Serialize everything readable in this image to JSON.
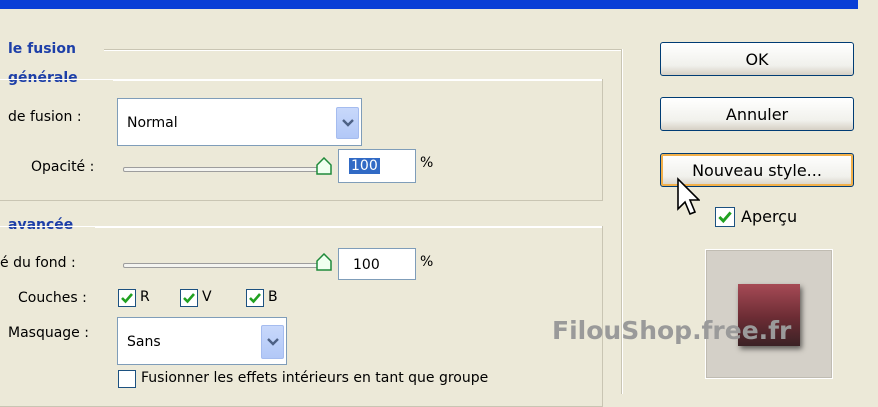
{
  "left_panel": {
    "blend_section_title": "le fusion",
    "general_section_title": "générale",
    "blend_mode_label": "de fusion :",
    "blend_mode_value": "Normal",
    "opacity_label": "Opacité :",
    "opacity_value": "100",
    "opacity_unit": "%",
    "opacity_level": 1.0,
    "advanced_section_title": "avancée",
    "fill_opacity_label": "é du fond :",
    "fill_opacity_value": "100",
    "fill_opacity_unit": "%",
    "fill_opacity_level": 1.0,
    "channels_label": "Couches :",
    "channels": [
      {
        "label": "R",
        "checked": true
      },
      {
        "label": "V",
        "checked": true
      },
      {
        "label": "B",
        "checked": true
      }
    ],
    "knockout_label": "Masquage :",
    "knockout_value": "Sans",
    "blend_interior_label": "Fusionner les effets intérieurs en tant que groupe",
    "blend_interior_checked": false
  },
  "right_panel": {
    "ok_label": "OK",
    "cancel_label": "Annuler",
    "new_style_label": "Nouveau style...",
    "preview_label": "Aperçu",
    "preview_checked": true
  },
  "watermark": "FilouShop.free.fr",
  "colors": {
    "accent": "#1d3fa8",
    "title_bar": "#0a3fd6",
    "check": "#21a121",
    "preview_swatch": "#8a3a44"
  }
}
